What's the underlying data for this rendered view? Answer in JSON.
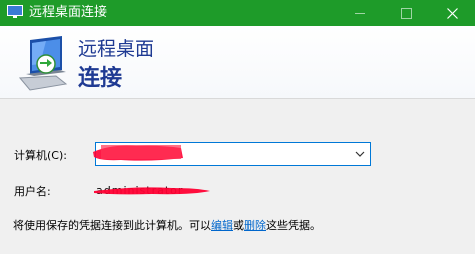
{
  "window": {
    "title": "远程桌面连接",
    "titlebar_color": "#1e9b29",
    "icons": {
      "app": "remote-desktop-icon",
      "minimize": "minimize-icon",
      "maximize": "maximize-icon",
      "close": "close-icon"
    }
  },
  "header": {
    "line1": "远程桌面",
    "line2": "连接",
    "text_color": "#1f3a93",
    "icon": "remote-desktop-monitor-icon"
  },
  "form": {
    "computer_label": "计算机(C):",
    "computer_value": "",
    "computer_dropdown_icon": "chevron-down-icon",
    "user_label": "用户名:",
    "user_value": "administrator"
  },
  "note": {
    "prefix": "将使用保存的凭据连接到此计算机。可以",
    "edit_link": "编辑",
    "middle": "或",
    "delete_link": "删除",
    "suffix": "这些凭据。",
    "link_color": "#0066cc"
  },
  "redaction_color": "#ff0033"
}
